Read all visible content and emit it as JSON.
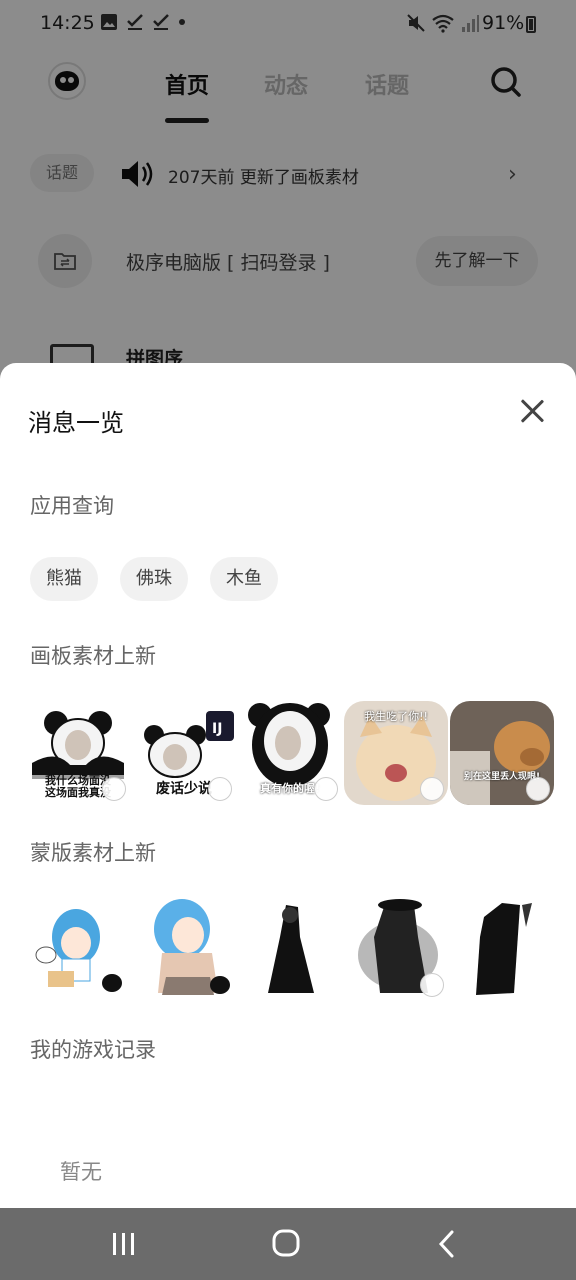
{
  "status_bar": {
    "time": "14:25",
    "battery": "91%"
  },
  "header": {
    "tabs": [
      {
        "label": "首页"
      },
      {
        "label": "动态"
      },
      {
        "label": "话题"
      }
    ]
  },
  "notice": {
    "tag": "话题",
    "text": "207天前 更新了画板素材"
  },
  "pc_banner": {
    "text": "极序电脑版 [ 扫码登录 ]",
    "button": "先了解一下"
  },
  "feature_row": {
    "label": "拼图序"
  },
  "sheet": {
    "title": "消息一览",
    "sections": {
      "app_query": {
        "title": "应用查询",
        "chips": [
          "熊猫",
          "佛珠",
          "木鱼"
        ]
      },
      "board_materials": {
        "title": "画板素材上新",
        "items": [
          {
            "caption": "我什么场面没\n这场面我真没"
          },
          {
            "caption": "废话少说"
          },
          {
            "caption": "真有你的喔!"
          },
          {
            "caption": "我生吃了你!!"
          },
          {
            "caption": "别在这里丢人现眼!"
          }
        ]
      },
      "mask_materials": {
        "title": "蒙版素材上新"
      },
      "game_records": {
        "title": "我的游戏记录",
        "empty": "暂无"
      }
    }
  }
}
